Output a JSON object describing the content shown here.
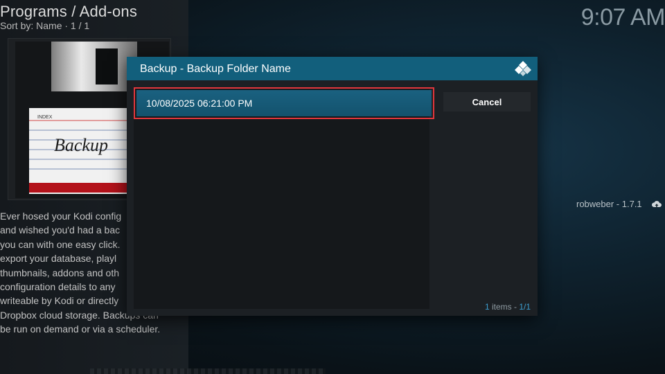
{
  "header": {
    "title": "Programs / Add-ons",
    "sort": "Sort by: Name  ·  1 / 1"
  },
  "clock": "9:07 AM",
  "addon": {
    "art_label_index": "INDEX",
    "art_label_title": "Backup",
    "description": "Ever hosed your Kodi config\nand wished you'd had a bac\nyou can with one easy click.\nexport your database, playl\nthumbnails, addons and oth\nconfiguration details to any\nwriteable by Kodi or directly\nDropbox cloud storage. Backups can\nbe run on demand or via a scheduler.",
    "author_version": "robweber - 1.7.1"
  },
  "dialog": {
    "title": "Backup - Backup Folder Name",
    "items": [
      {
        "label": "10/08/2025 06:21:00 PM"
      }
    ],
    "cancel_label": "Cancel",
    "count_number": "1",
    "count_text": " items - ",
    "count_page": "1/1"
  },
  "colors": {
    "dialog_header": "#125f7c",
    "selection_outline": "#e2373d",
    "accent": "#3d9fd1"
  },
  "icons": [
    "kodi-logo-icon",
    "cloud-upload-icon",
    "floppy-disk-art"
  ]
}
